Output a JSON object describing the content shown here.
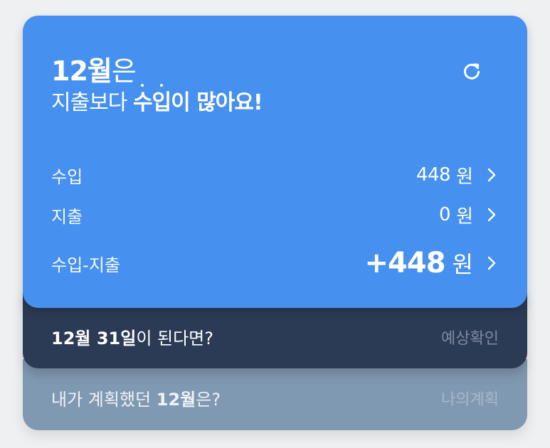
{
  "summary": {
    "month": "12월",
    "month_suffix": "은",
    "sub_prefix": "지출보다 ",
    "emph_su": "수",
    "emph_ip": "입",
    "emph_rest": "이 많아요!"
  },
  "icons": {
    "refresh": "refresh-icon",
    "chevron": "chevron-right-icon"
  },
  "rows": [
    {
      "label": "수입",
      "amount": "448",
      "unit": "원"
    },
    {
      "label": "지출",
      "amount": "0",
      "unit": "원"
    },
    {
      "label": "수입-지출",
      "amount": "+448",
      "unit": "원"
    }
  ],
  "forecast": {
    "date": "12월 31일",
    "suffix": "이 된다면?",
    "link": "예상확인"
  },
  "plan": {
    "prefix": "내가 계획했던 ",
    "month": "12월",
    "suffix": "은?",
    "link": "나의계획"
  },
  "colors": {
    "card": "#4690ef",
    "forecast_bg": "#2c3b55",
    "plan_bg": "#8099b2",
    "page_bg": "#eef0f2"
  }
}
